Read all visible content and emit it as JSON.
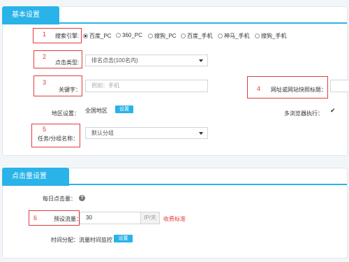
{
  "basic": {
    "title": "基本设置",
    "engine_label": "搜索引擎:",
    "engines": [
      "百度_PC",
      "360_PC",
      "搜狗_PC",
      "百度_手机",
      "神马_手机",
      "搜狗_手机"
    ],
    "click_type_label": "点击类型:",
    "click_type_value": "排名点击(100名内)",
    "keyword_label": "关键字：",
    "keyword_placeholder": "例如：手机",
    "site_label": "网址或网站快照标题：",
    "region_label": "地区设置：",
    "region_value": "全国地区",
    "region_btn": "设置",
    "multi_browser_label": "多浏览器执行：",
    "multi_browser_check": "✔",
    "group_label": "任务/分组名称：",
    "group_value": "默认分组"
  },
  "clicks": {
    "title": "点击量设置",
    "daily_label": "每日点击量：",
    "daily_help": "?",
    "preset_label": "预设流量：",
    "preset_value": "30",
    "preset_suffix": "IP/天",
    "fee_link": "收费标准",
    "time_label": "时间分配：流量时间监控",
    "time_btn": "设置"
  },
  "markers": [
    "1",
    "2",
    "3",
    "4",
    "5",
    "6"
  ]
}
